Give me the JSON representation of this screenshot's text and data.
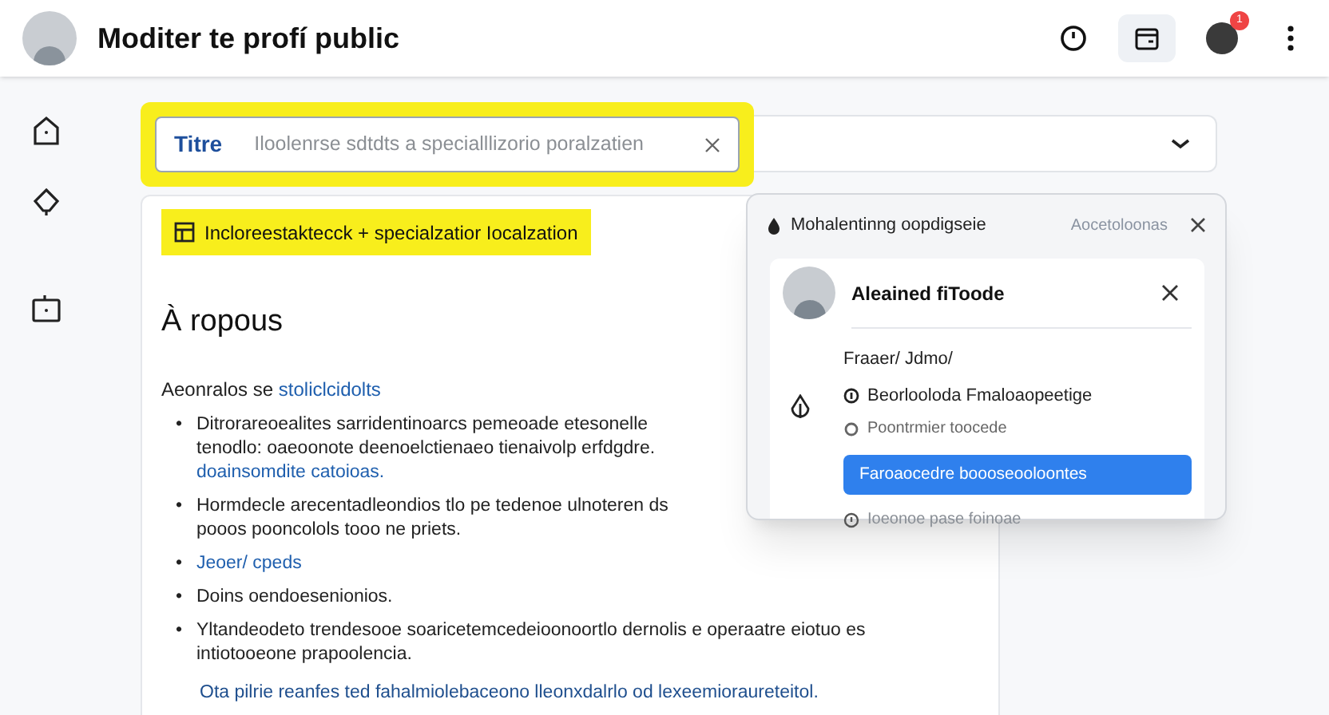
{
  "header": {
    "title": "Moditer te profí public",
    "badge": "1"
  },
  "search": {
    "label": "Titre",
    "placeholder": "Iloolenrse sdtdts a specialllizorio poralzatien"
  },
  "highlight_chip": {
    "text": "Incloreestaktecck + specialzatior Iocalzation"
  },
  "about": {
    "heading": "À ropous",
    "subheading": "Aeonralos se",
    "subheading_link": "stoliclcidolts",
    "bullets": [
      {
        "marker": "•",
        "text": "Ditrorareoealites sarridentinoarcs pemeoade etesonelle tenodlo: oaeoonote deenoelctienaeo tienaivolp erfdgdre.",
        "link": "doainsomdite catoioas."
      },
      {
        "marker": "•",
        "text": "Hormdecle arecentadleondios tlo pe tedenoe ulnoteren ds pooos pooncolols tooo ne priets."
      },
      {
        "marker": "•",
        "link": "Jeoer/ cpeds"
      },
      {
        "marker": "•",
        "text": "Doins oendoesenionios."
      },
      {
        "marker": "•",
        "text": "Yltandeodeto trendesooe soaricetemcedeioonoortlo dernolis e operaatre eiotuo es intiotooeone prapoolencia."
      }
    ],
    "footer_link": "Ota pilrie reanfes ted fahalmiolebaceono lleonxdalrlo od lexeemioraureteitol."
  },
  "popup": {
    "title": "Mohalentinng oopdigseie",
    "action": "Aocetoloonas",
    "card": {
      "name": "Aleained fiToode",
      "label": "Fraaer/ Jdmo/",
      "items": [
        {
          "kind": "primary",
          "text": "Beorlooloda Fmaloaopeetige"
        },
        {
          "kind": "secondary",
          "text": "Poontrmier toocede"
        }
      ],
      "button": "Faroaocedre boooseooloontes",
      "note": "Ioeonoe pase foinoae"
    }
  }
}
